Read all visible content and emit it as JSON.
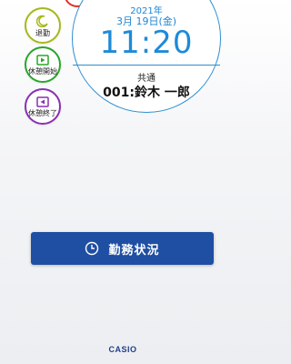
{
  "side_buttons": {
    "clock_out": {
      "label": "退勤",
      "color": "#a6b81a"
    },
    "break_start": {
      "label": "休憩開始",
      "color": "#2aa52a"
    },
    "break_end": {
      "label": "休憩終了",
      "color": "#8a2fb3"
    },
    "partial_top_color": "#e0332b"
  },
  "clock": {
    "year": "2021年",
    "date": "3月 19日(金)",
    "time": "11:20",
    "group": "共通",
    "user": "001:鈴木 一郎"
  },
  "status_button": {
    "label": "勤務状況",
    "icon": "clock-icon"
  },
  "brand": "CASIO"
}
